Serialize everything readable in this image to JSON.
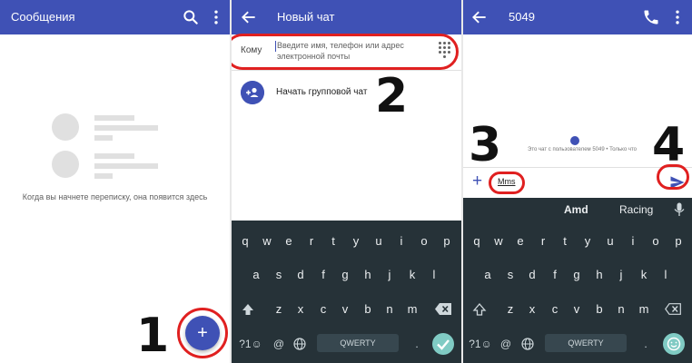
{
  "colors": {
    "primary": "#3f51b5",
    "annotation": "#e02020",
    "keyboard_bg": "#263238",
    "done_key": "#80cbc4"
  },
  "messages_panel": {
    "title": "Сообщения",
    "empty_text": "Когда вы начнете переписку, она появится здесь",
    "fab_icon": "+",
    "step_number": "1"
  },
  "new_chat_panel": {
    "title": "Новый чат",
    "to_label": "Кому",
    "to_placeholder": "Введите имя, телефон или адрес электронной почты",
    "group_chat_label": "Начать групповой чат",
    "step_number": "2"
  },
  "chat_panel": {
    "title": "5049",
    "chat_info": "Это чат с пользователем 5049 • Только что",
    "attach_icon": "+",
    "message_text": "Mms",
    "step_number_left": "3",
    "step_number_right": "4",
    "suggestions": [
      "Amd",
      "Racing"
    ]
  },
  "keyboard": {
    "row1": [
      "q",
      "w",
      "e",
      "r",
      "t",
      "y",
      "u",
      "i",
      "o",
      "p"
    ],
    "row2": [
      "a",
      "s",
      "d",
      "f",
      "g",
      "h",
      "j",
      "k",
      "l"
    ],
    "row3": [
      "z",
      "x",
      "c",
      "v",
      "b",
      "n",
      "m"
    ],
    "symbols_key": "?1☺",
    "at_key": "@",
    "period_key": ".",
    "space_label": "QWERTY"
  }
}
